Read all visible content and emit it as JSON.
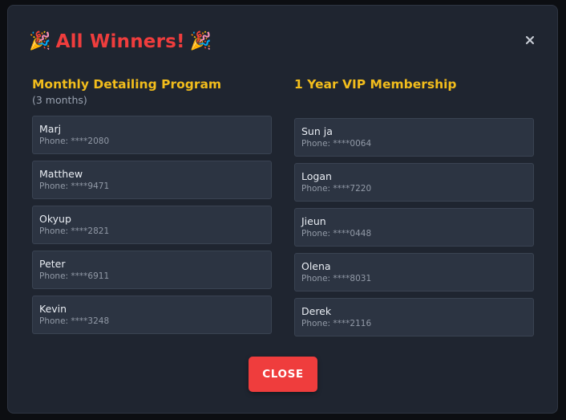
{
  "modal": {
    "title_prefix_emoji": "🎉",
    "title": "All Winners!",
    "title_suffix_emoji": "🎉",
    "close_icon": "close-icon",
    "close_button_label": "CLOSE",
    "colors": {
      "title": "#ef3d3d",
      "section_title": "#f2bd1c",
      "button": "#ef3d3d",
      "panel": "#1f2530",
      "card": "#2c3442"
    }
  },
  "columns": [
    {
      "title": "Monthly Detailing Program",
      "subtitle": "(3 months)",
      "winners": [
        {
          "name": "Marj",
          "phone": "Phone: ****2080"
        },
        {
          "name": "Matthew",
          "phone": "Phone: ****9471"
        },
        {
          "name": "Okyup",
          "phone": "Phone: ****2821"
        },
        {
          "name": "Peter",
          "phone": "Phone: ****6911"
        },
        {
          "name": "Kevin",
          "phone": "Phone: ****3248"
        }
      ]
    },
    {
      "title": "1 Year VIP Membership",
      "winners": [
        {
          "name": "Sun ja",
          "phone": "Phone: ****0064"
        },
        {
          "name": "Logan",
          "phone": "Phone: ****7220"
        },
        {
          "name": "Jieun",
          "phone": "Phone: ****0448"
        },
        {
          "name": "Olena",
          "phone": "Phone: ****8031"
        },
        {
          "name": "Derek",
          "phone": "Phone: ****2116"
        }
      ]
    }
  ]
}
